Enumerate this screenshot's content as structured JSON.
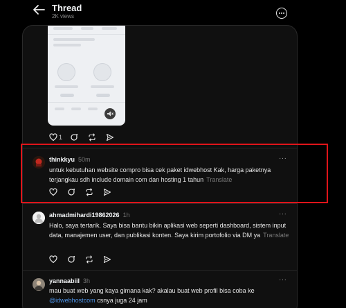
{
  "header": {
    "title": "Thread",
    "views": "2K views"
  },
  "first_post": {
    "like_count": "1"
  },
  "replies": [
    {
      "username": "thinkkyu",
      "time": "50m",
      "text": "untuk kebutuhan website compro bisa cek paket idwebhost Kak, harga paketnya terjangkau sdh include domain com dan hosting 1 tahun",
      "translate": "Translate",
      "more": "···"
    },
    {
      "username": "ahmadmihardi19862026",
      "time": "1h",
      "text": "Halo, saya tertarik. Saya bisa bantu bikin aplikasi web seperti dashboard, sistem input data, manajemen user, dan publikasi konten. Saya kirim portofolio via DM ya",
      "translate": "Translate",
      "more": "···"
    },
    {
      "username": "yannaabiil",
      "time": "3h",
      "text_before": "mau buat web yang kaya gimana kak? akalau buat web profil bisa coba ke",
      "mention": "@idwebhostcom",
      "text_after": "csnya juga 24 jam",
      "more": "···"
    }
  ],
  "colors": {
    "background": "#000000",
    "card": "#101010",
    "highlight_border": "#e0141a",
    "mention": "#4e94e8",
    "muted_text": "#777777"
  }
}
